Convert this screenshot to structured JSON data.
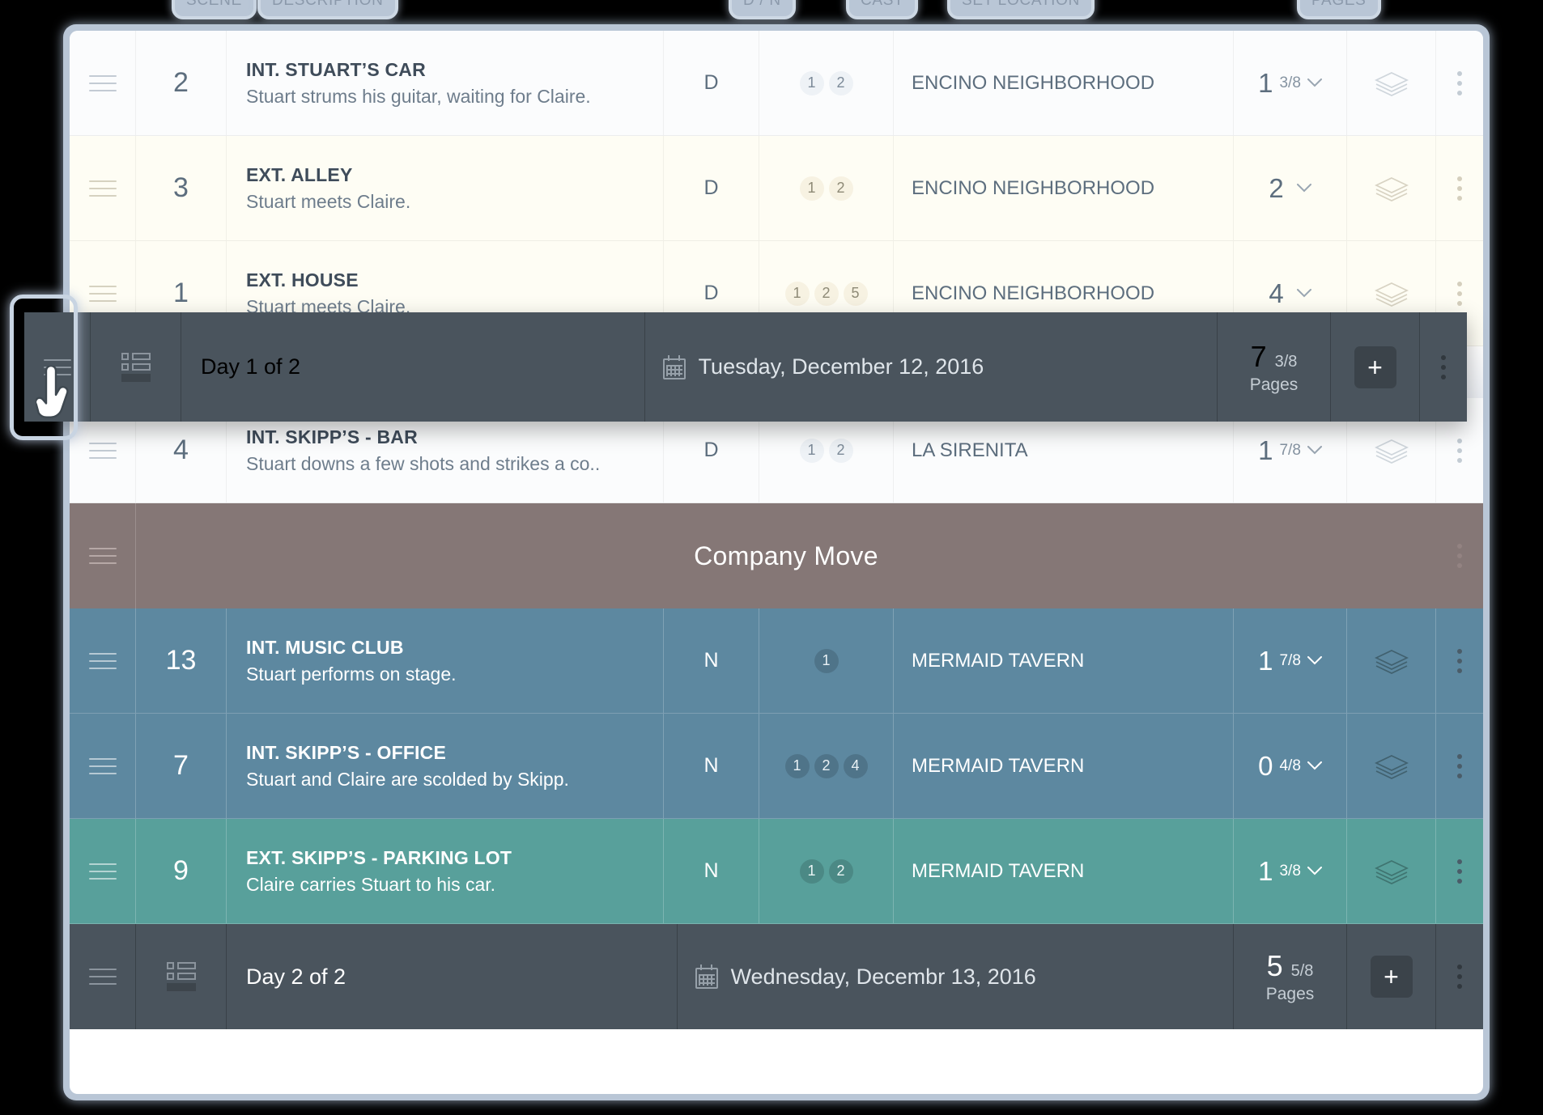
{
  "columns": [
    {
      "key": "scene",
      "label": "SCENE"
    },
    {
      "key": "desc",
      "label": "DESCRIPTION"
    },
    {
      "key": "dn",
      "label": "D / N"
    },
    {
      "key": "cast",
      "label": "CAST"
    },
    {
      "key": "location",
      "label": "SET LOCATION"
    },
    {
      "key": "pages",
      "label": "PAGES"
    }
  ],
  "rows": [
    {
      "type": "scene",
      "tint": "white",
      "scene": "2",
      "slug": "INT. STUART’S CAR",
      "synopsis": "Stuart strums his guitar, waiting for Claire.",
      "dn": "D",
      "cast": [
        "1",
        "2"
      ],
      "location": "ENCINO NEIGHBORHOOD",
      "pages_whole": "1",
      "pages_frac": "3/8"
    },
    {
      "type": "scene",
      "tint": "cream",
      "scene": "3",
      "slug": "EXT. ALLEY",
      "synopsis": "Stuart meets Claire.",
      "dn": "D",
      "cast": [
        "1",
        "2"
      ],
      "location": "ENCINO NEIGHBORHOOD",
      "pages_whole": "2",
      "pages_frac": ""
    },
    {
      "type": "scene",
      "tint": "cream",
      "scene": "1",
      "slug": "EXT. HOUSE",
      "synopsis": "Stuart meets Claire.",
      "dn": "D",
      "cast": [
        "1",
        "2",
        "5"
      ],
      "location": "ENCINO NEIGHBORHOOD",
      "pages_whole": "4",
      "pages_frac": ""
    },
    {
      "type": "scene",
      "tint": "white",
      "scene": "4",
      "slug": "INT. SKIPP’S - BAR",
      "synopsis": "Stuart downs a few shots and strikes a co..",
      "dn": "D",
      "cast": [
        "1",
        "2"
      ],
      "location": "LA SIRENITA",
      "pages_whole": "1",
      "pages_frac": "7/8"
    },
    {
      "type": "banner",
      "tint": "move",
      "title": "Company Move"
    },
    {
      "type": "scene",
      "tint": "blue",
      "scene": "13",
      "slug": "INT. MUSIC CLUB",
      "synopsis": "Stuart performs on stage.",
      "dn": "N",
      "cast": [
        "1"
      ],
      "location": "MERMAID TAVERN",
      "pages_whole": "1",
      "pages_frac": "7/8"
    },
    {
      "type": "scene",
      "tint": "blue",
      "scene": "7",
      "slug": "INT. SKIPP’S - OFFICE",
      "synopsis": "Stuart and Claire are scolded by Skipp.",
      "dn": "N",
      "cast": [
        "1",
        "2",
        "4"
      ],
      "location": "MERMAID TAVERN",
      "pages_whole": "0",
      "pages_frac": "4/8"
    },
    {
      "type": "scene",
      "tint": "teal",
      "scene": "9",
      "slug": "EXT. SKIPP’S - PARKING LOT",
      "synopsis": "Claire carries Stuart to his car.",
      "dn": "N",
      "cast": [
        "1",
        "2"
      ],
      "location": "MERMAID TAVERN",
      "pages_whole": "1",
      "pages_frac": "3/8"
    }
  ],
  "day_bar_floating": {
    "label": "Day 1 of 2",
    "date": "Tuesday, December 12, 2016",
    "pages_whole": "7",
    "pages_frac": "3/8",
    "pages_label": "Pages",
    "add_label": "+"
  },
  "day_bar_bottom": {
    "label": "Day 2 of 2",
    "date": "Wednesday, Decembr 13, 2016",
    "pages_whole": "5",
    "pages_frac": "5/8",
    "pages_label": "Pages",
    "add_label": "+"
  },
  "colors": {
    "dark_bar": "#4a545d",
    "row_blue": "#5d88a0",
    "row_teal": "#58a09b",
    "company_move": "#857776",
    "frame": "#b9c6d6",
    "row_cream": "#fefdf4"
  }
}
